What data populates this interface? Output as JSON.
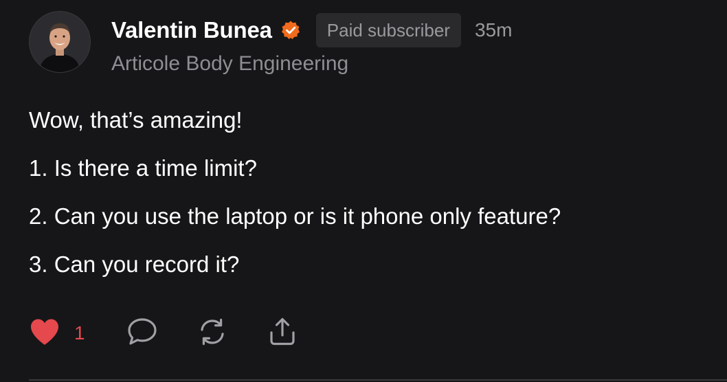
{
  "comment": {
    "author": {
      "name": "Valentin Bunea",
      "verified_icon": "verified-check-icon",
      "badge": "Paid subscriber",
      "time": "35m",
      "publication": "Articole Body Engineering",
      "accent_color": "#F26B1D"
    },
    "body": [
      "Wow, that’s amazing!",
      "1. Is there a time limit?",
      "2. Can you use the laptop or is it phone only feature?",
      "3. Can you record it?"
    ],
    "actions": {
      "like": {
        "icon": "heart-icon",
        "count": "1",
        "color": "#E5484D"
      },
      "comment": {
        "icon": "comment-icon"
      },
      "restack": {
        "icon": "restack-icon"
      },
      "share": {
        "icon": "share-icon"
      }
    }
  }
}
